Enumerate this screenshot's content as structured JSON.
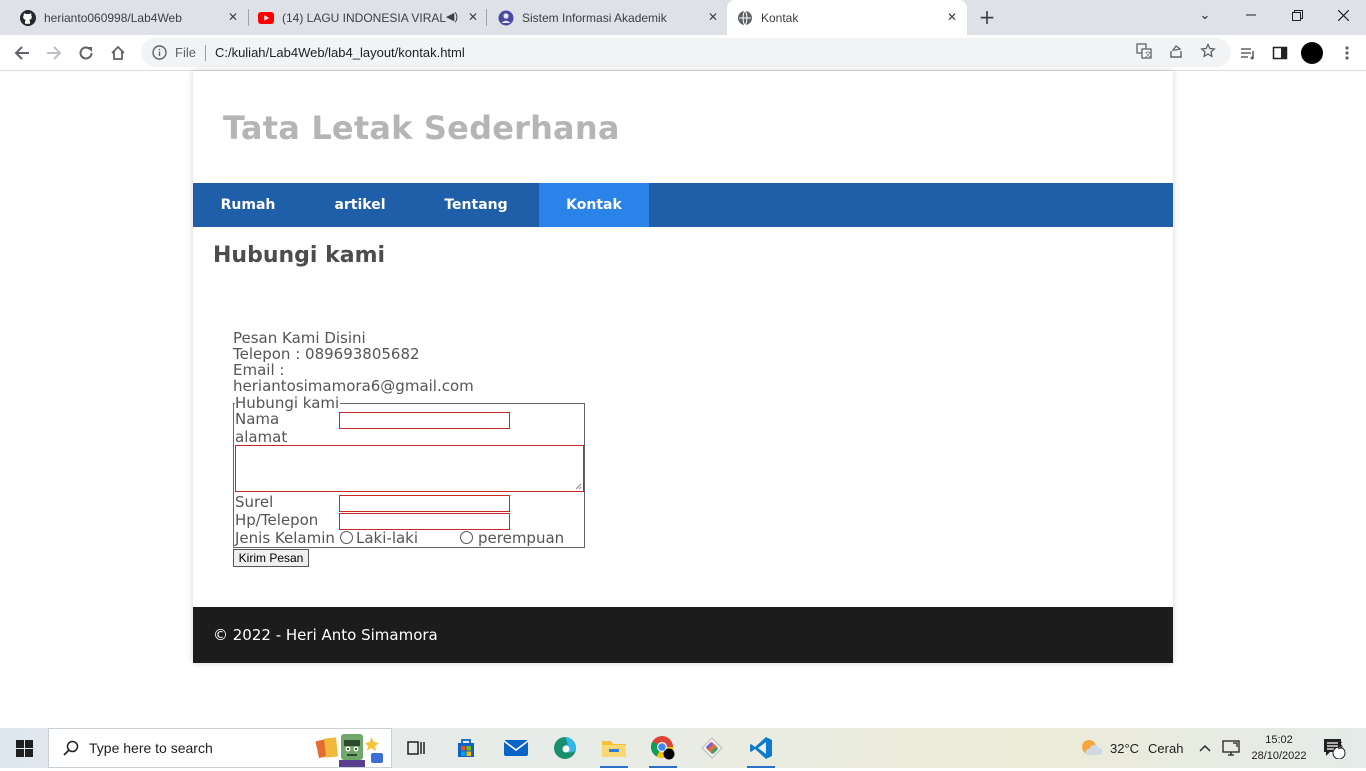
{
  "browser": {
    "tabs": [
      {
        "title": "herianto060998/Lab4Web",
        "icon": "github-icon"
      },
      {
        "title": "(14) LAGU INDONESIA VIRAL",
        "icon": "youtube-icon"
      },
      {
        "title": "Sistem Informasi Akademik",
        "icon": "university-icon"
      },
      {
        "title": "Kontak",
        "icon": "globe-icon"
      }
    ],
    "address": {
      "scheme_label": "File",
      "url": "C:/kuliah/Lab4Web/lab4_layout/kontak.html"
    }
  },
  "page": {
    "site_title": "Tata Letak Sederhana",
    "nav": [
      "Rumah",
      "artikel",
      "Tentang",
      "Kontak"
    ],
    "active_nav": "Kontak",
    "section_title": "Hubungi kami",
    "contact": {
      "heading": "Pesan Kami Disini",
      "phone": "Telepon : 089693805682",
      "email_label": "Email :",
      "email": "heriantosimamora6@gmail.com"
    },
    "form": {
      "legend": "Hubungi kami",
      "name_label": "Nama",
      "address_label": "alamat",
      "email_label": "Surel",
      "phone_label": "Hp/Telepon",
      "gender_label": "Jenis Kelamin",
      "gender_options": [
        "Laki-laki",
        "perempuan"
      ],
      "submit_label": "Kirim Pesan"
    },
    "footer": "© 2022 - Heri Anto Simamora"
  },
  "taskbar": {
    "search_placeholder": "Type here to search",
    "weather": {
      "temp": "32°C",
      "condition": "Cerah"
    },
    "clock": {
      "time": "15:02",
      "date": "28/10/2022"
    },
    "notification_count": "5"
  },
  "colors": {
    "nav": "#1f5faa",
    "nav_active": "#2b83ea",
    "footer": "#1c1c1c",
    "title": "#b5b5b5"
  }
}
